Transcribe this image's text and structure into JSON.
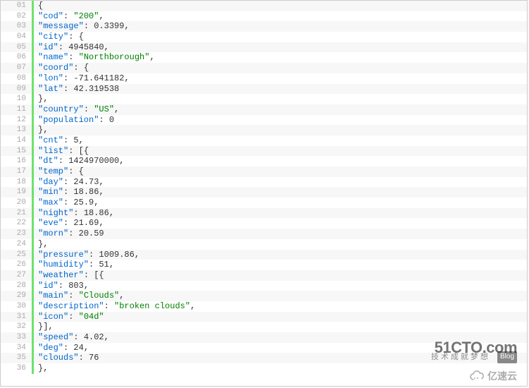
{
  "watermarks": {
    "w1_big": "51CTO.com",
    "w1_small_cn": "技术成就梦想",
    "w1_blog": "Blog",
    "w2_text": "亿速云"
  },
  "code_lines": [
    {
      "n": "01",
      "tokens": [
        {
          "t": "{",
          "c": "punct"
        }
      ]
    },
    {
      "n": "02",
      "tokens": [
        {
          "t": "\"cod\"",
          "c": "key"
        },
        {
          "t": ": ",
          "c": "punct"
        },
        {
          "t": "\"200\"",
          "c": "str"
        },
        {
          "t": ",",
          "c": "punct"
        }
      ]
    },
    {
      "n": "03",
      "tokens": [
        {
          "t": "\"message\"",
          "c": "key"
        },
        {
          "t": ": ",
          "c": "punct"
        },
        {
          "t": "0.3399",
          "c": "num"
        },
        {
          "t": ",",
          "c": "punct"
        }
      ]
    },
    {
      "n": "04",
      "tokens": [
        {
          "t": "\"city\"",
          "c": "key"
        },
        {
          "t": ": {",
          "c": "punct"
        }
      ]
    },
    {
      "n": "05",
      "tokens": [
        {
          "t": "\"id\"",
          "c": "key"
        },
        {
          "t": ": ",
          "c": "punct"
        },
        {
          "t": "4945840",
          "c": "num"
        },
        {
          "t": ",",
          "c": "punct"
        }
      ]
    },
    {
      "n": "06",
      "tokens": [
        {
          "t": "\"name\"",
          "c": "key"
        },
        {
          "t": ": ",
          "c": "punct"
        },
        {
          "t": "\"Northborough\"",
          "c": "str"
        },
        {
          "t": ",",
          "c": "punct"
        }
      ]
    },
    {
      "n": "07",
      "tokens": [
        {
          "t": "\"coord\"",
          "c": "key"
        },
        {
          "t": ": {",
          "c": "punct"
        }
      ]
    },
    {
      "n": "08",
      "tokens": [
        {
          "t": "\"lon\"",
          "c": "key"
        },
        {
          "t": ": ",
          "c": "punct"
        },
        {
          "t": "-71.641182",
          "c": "num"
        },
        {
          "t": ",",
          "c": "punct"
        }
      ]
    },
    {
      "n": "09",
      "tokens": [
        {
          "t": "\"lat\"",
          "c": "key"
        },
        {
          "t": ": ",
          "c": "punct"
        },
        {
          "t": "42.319538",
          "c": "num"
        }
      ]
    },
    {
      "n": "10",
      "tokens": [
        {
          "t": "},",
          "c": "punct"
        }
      ]
    },
    {
      "n": "11",
      "tokens": [
        {
          "t": "\"country\"",
          "c": "key"
        },
        {
          "t": ": ",
          "c": "punct"
        },
        {
          "t": "\"US\"",
          "c": "str"
        },
        {
          "t": ",",
          "c": "punct"
        }
      ]
    },
    {
      "n": "12",
      "tokens": [
        {
          "t": "\"population\"",
          "c": "key"
        },
        {
          "t": ": ",
          "c": "punct"
        },
        {
          "t": "0",
          "c": "num"
        }
      ]
    },
    {
      "n": "13",
      "tokens": [
        {
          "t": "},",
          "c": "punct"
        }
      ]
    },
    {
      "n": "14",
      "tokens": [
        {
          "t": "\"cnt\"",
          "c": "key"
        },
        {
          "t": ": ",
          "c": "punct"
        },
        {
          "t": "5",
          "c": "num"
        },
        {
          "t": ",",
          "c": "punct"
        }
      ]
    },
    {
      "n": "15",
      "tokens": [
        {
          "t": "\"list\"",
          "c": "key"
        },
        {
          "t": ": [{",
          "c": "punct"
        }
      ]
    },
    {
      "n": "16",
      "tokens": [
        {
          "t": "\"dt\"",
          "c": "key"
        },
        {
          "t": ": ",
          "c": "punct"
        },
        {
          "t": "1424970000",
          "c": "num"
        },
        {
          "t": ",",
          "c": "punct"
        }
      ]
    },
    {
      "n": "17",
      "tokens": [
        {
          "t": "\"temp\"",
          "c": "key"
        },
        {
          "t": ": {",
          "c": "punct"
        }
      ]
    },
    {
      "n": "18",
      "tokens": [
        {
          "t": "\"day\"",
          "c": "key"
        },
        {
          "t": ": ",
          "c": "punct"
        },
        {
          "t": "24.73",
          "c": "num"
        },
        {
          "t": ",",
          "c": "punct"
        }
      ]
    },
    {
      "n": "19",
      "tokens": [
        {
          "t": "\"min\"",
          "c": "key"
        },
        {
          "t": ": ",
          "c": "punct"
        },
        {
          "t": "18.86",
          "c": "num"
        },
        {
          "t": ",",
          "c": "punct"
        }
      ]
    },
    {
      "n": "20",
      "tokens": [
        {
          "t": "\"max\"",
          "c": "key"
        },
        {
          "t": ": ",
          "c": "punct"
        },
        {
          "t": "25.9",
          "c": "num"
        },
        {
          "t": ",",
          "c": "punct"
        }
      ]
    },
    {
      "n": "21",
      "tokens": [
        {
          "t": "\"night\"",
          "c": "key"
        },
        {
          "t": ": ",
          "c": "punct"
        },
        {
          "t": "18.86",
          "c": "num"
        },
        {
          "t": ",",
          "c": "punct"
        }
      ]
    },
    {
      "n": "22",
      "tokens": [
        {
          "t": "\"eve\"",
          "c": "key"
        },
        {
          "t": ": ",
          "c": "punct"
        },
        {
          "t": "21.69",
          "c": "num"
        },
        {
          "t": ",",
          "c": "punct"
        }
      ]
    },
    {
      "n": "23",
      "tokens": [
        {
          "t": "\"morn\"",
          "c": "key"
        },
        {
          "t": ": ",
          "c": "punct"
        },
        {
          "t": "20.59",
          "c": "num"
        }
      ]
    },
    {
      "n": "24",
      "tokens": [
        {
          "t": "},",
          "c": "punct"
        }
      ]
    },
    {
      "n": "25",
      "tokens": [
        {
          "t": "\"pressure\"",
          "c": "key"
        },
        {
          "t": ": ",
          "c": "punct"
        },
        {
          "t": "1009.86",
          "c": "num"
        },
        {
          "t": ",",
          "c": "punct"
        }
      ]
    },
    {
      "n": "26",
      "tokens": [
        {
          "t": "\"humidity\"",
          "c": "key"
        },
        {
          "t": ": ",
          "c": "punct"
        },
        {
          "t": "51",
          "c": "num"
        },
        {
          "t": ",",
          "c": "punct"
        }
      ]
    },
    {
      "n": "27",
      "tokens": [
        {
          "t": "\"weather\"",
          "c": "key"
        },
        {
          "t": ": [{",
          "c": "punct"
        }
      ]
    },
    {
      "n": "28",
      "tokens": [
        {
          "t": "\"id\"",
          "c": "key"
        },
        {
          "t": ": ",
          "c": "punct"
        },
        {
          "t": "803",
          "c": "num"
        },
        {
          "t": ",",
          "c": "punct"
        }
      ]
    },
    {
      "n": "29",
      "tokens": [
        {
          "t": "\"main\"",
          "c": "key"
        },
        {
          "t": ": ",
          "c": "punct"
        },
        {
          "t": "\"Clouds\"",
          "c": "str"
        },
        {
          "t": ",",
          "c": "punct"
        }
      ]
    },
    {
      "n": "30",
      "tokens": [
        {
          "t": "\"description\"",
          "c": "key"
        },
        {
          "t": ": ",
          "c": "punct"
        },
        {
          "t": "\"broken clouds\"",
          "c": "str"
        },
        {
          "t": ",",
          "c": "punct"
        }
      ]
    },
    {
      "n": "31",
      "tokens": [
        {
          "t": "\"icon\"",
          "c": "key"
        },
        {
          "t": ": ",
          "c": "punct"
        },
        {
          "t": "\"04d\"",
          "c": "str"
        }
      ]
    },
    {
      "n": "32",
      "tokens": [
        {
          "t": "}],",
          "c": "punct"
        }
      ]
    },
    {
      "n": "33",
      "tokens": [
        {
          "t": "\"speed\"",
          "c": "key"
        },
        {
          "t": ": ",
          "c": "punct"
        },
        {
          "t": "4.02",
          "c": "num"
        },
        {
          "t": ",",
          "c": "punct"
        }
      ]
    },
    {
      "n": "34",
      "tokens": [
        {
          "t": "\"deg\"",
          "c": "key"
        },
        {
          "t": ": ",
          "c": "punct"
        },
        {
          "t": "24",
          "c": "num"
        },
        {
          "t": ",",
          "c": "punct"
        }
      ]
    },
    {
      "n": "35",
      "tokens": [
        {
          "t": "\"clouds\"",
          "c": "key"
        },
        {
          "t": ": ",
          "c": "punct"
        },
        {
          "t": "76",
          "c": "num"
        }
      ]
    },
    {
      "n": "36",
      "tokens": [
        {
          "t": "},",
          "c": "punct"
        }
      ]
    }
  ]
}
